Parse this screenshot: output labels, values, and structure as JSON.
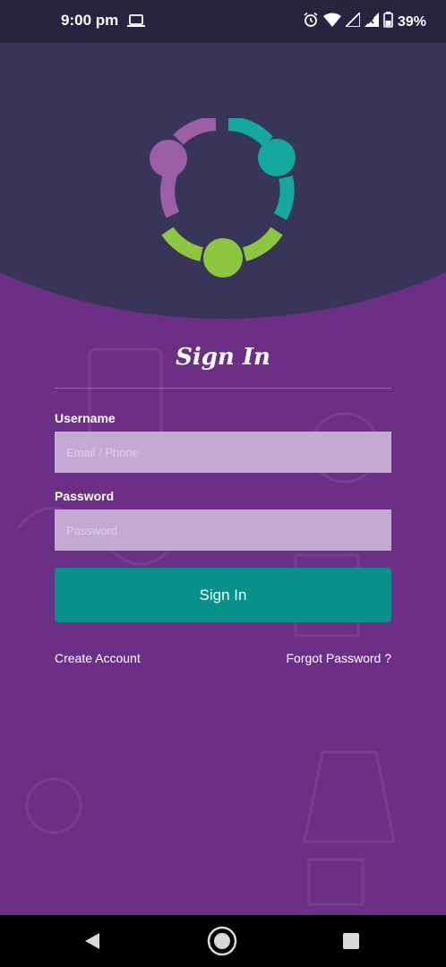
{
  "status_bar": {
    "time": "9:00 pm",
    "battery_percent": "39%",
    "icons": [
      "laptop-icon",
      "alarm-icon",
      "wifi-icon",
      "signal-icon",
      "signal-icon",
      "battery-icon"
    ]
  },
  "logo": {
    "icon": "circle-of-people-logo",
    "colors": {
      "purple": "#9b5fa6",
      "teal": "#14a8a1",
      "green": "#8dc63f"
    }
  },
  "sign_in": {
    "title": "Sign In",
    "username_label": "Username",
    "username_placeholder": "Email / Phone",
    "username_value": "",
    "password_label": "Password",
    "password_placeholder": "Password",
    "password_value": "",
    "submit_label": "Sign In"
  },
  "links": {
    "create_account": "Create Account",
    "forgot_password": "Forgot Password ?"
  },
  "nav_bar": {
    "icons": [
      "back-icon",
      "home-icon",
      "recents-icon"
    ]
  },
  "colors": {
    "background": "#6b3086",
    "header": "#393558",
    "status_bar": "#262440",
    "input": "#c4aad3",
    "button": "#08918a"
  }
}
